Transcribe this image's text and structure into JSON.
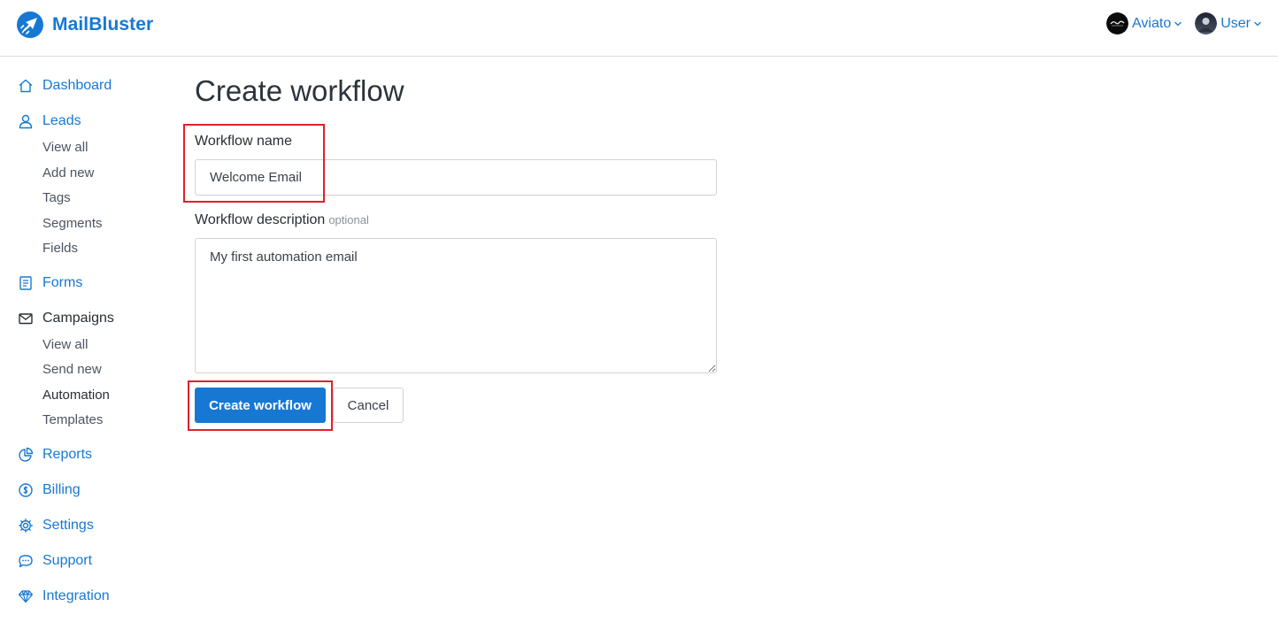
{
  "brand": {
    "name": "MailBluster",
    "accent": "#1778d4",
    "logo_icon": "rocket-logo-icon"
  },
  "header": {
    "org_account": {
      "label": "Aviato",
      "icon": "chevron-down-icon"
    },
    "user_account": {
      "label": "User",
      "icon": "chevron-down-icon"
    }
  },
  "sidebar": {
    "dashboard": {
      "label": "Dashboard",
      "icon": "home-icon"
    },
    "leads": {
      "label": "Leads",
      "icon": "person-icon",
      "items": [
        "View all",
        "Add new",
        "Tags",
        "Segments",
        "Fields"
      ]
    },
    "forms": {
      "label": "Forms",
      "icon": "form-icon"
    },
    "campaigns": {
      "label": "Campaigns",
      "icon": "envelope-icon",
      "items": [
        "View all",
        "Send new",
        "Automation",
        "Templates"
      ],
      "active_item": "Automation"
    },
    "reports": {
      "label": "Reports",
      "icon": "pie-chart-icon"
    },
    "billing": {
      "label": "Billing",
      "icon": "dollar-circle-icon"
    },
    "settings": {
      "label": "Settings",
      "icon": "gear-icon"
    },
    "support": {
      "label": "Support",
      "icon": "chat-bubble-icon"
    },
    "integration": {
      "label": "Integration",
      "icon": "diamond-icon"
    }
  },
  "main": {
    "title": "Create workflow",
    "name_field": {
      "label": "Workflow name",
      "value": "Welcome Email"
    },
    "description_field": {
      "label": "Workflow description",
      "optional_tag": "optional",
      "value": "My first automation email"
    },
    "submit_label": "Create workflow",
    "cancel_label": "Cancel"
  },
  "annotation_color": "#e0202a"
}
